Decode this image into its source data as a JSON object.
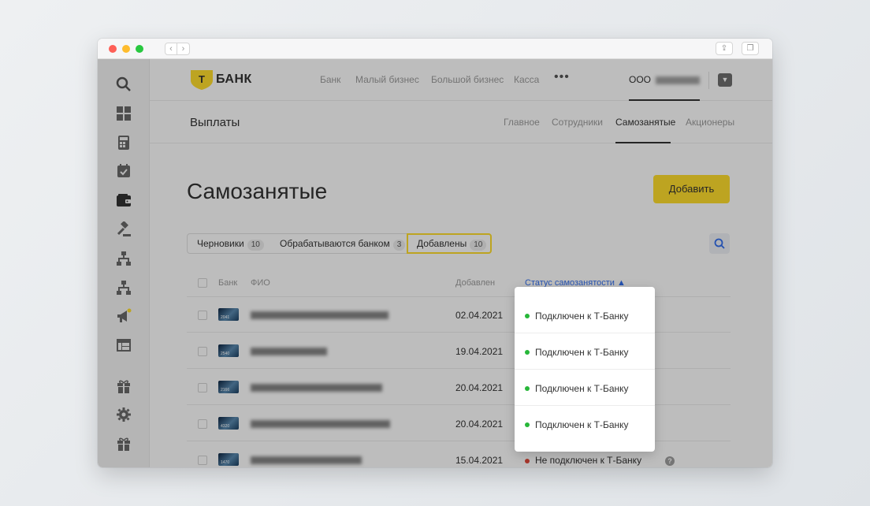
{
  "brand": {
    "name": "БАНК",
    "logo_letter": "Т",
    "logo_color": "#ffdd2d"
  },
  "topnav": {
    "items": [
      "Банк",
      "Малый бизнес",
      "Большой бизнес",
      "Касса"
    ],
    "more": "•••",
    "org_label": "ООО",
    "menu_icon": "chevron-down-icon"
  },
  "section": {
    "title": "Выплаты",
    "tabs": [
      "Главное",
      "Сотрудники",
      "Самозанятые",
      "Акционеры"
    ],
    "active_tab": "Самозанятые"
  },
  "page": {
    "title": "Самозанятые",
    "add_button": "Добавить"
  },
  "filters": [
    {
      "label": "Черновики",
      "count": "10"
    },
    {
      "label": "Обрабатываются банком",
      "count": "3"
    },
    {
      "label": "Добавлены",
      "count": "10",
      "active": true
    }
  ],
  "table": {
    "headers": {
      "bank": "Банк",
      "name": "ФИО",
      "added": "Добавлен",
      "status": "Статус самозанятости ▲"
    },
    "rows": [
      {
        "card": "2041",
        "date": "02.04.2021",
        "status": "Подключен к Т-Банку",
        "status_color": "#27b739"
      },
      {
        "card": "2540",
        "date": "19.04.2021",
        "status": "Подключен к Т-Банку",
        "status_color": "#27b739"
      },
      {
        "card": "2166",
        "date": "20.04.2021",
        "status": "Подключен к Т-Банку",
        "status_color": "#27b739"
      },
      {
        "card": "4320",
        "date": "20.04.2021",
        "status": "Подключен к Т-Банку",
        "status_color": "#27b739"
      },
      {
        "card": "1470",
        "date": "15.04.2021",
        "status": "Не подключен к Т-Банку",
        "status_color": "#e04a3b"
      }
    ]
  },
  "popover": {
    "items": [
      "Подключен к Т-Банку",
      "Подключен к Т-Банку",
      "Подключен к Т-Банку",
      "Подключен к Т-Банку"
    ]
  },
  "sidebar_icons": [
    "search-icon",
    "dashboard-icon",
    "calculator-icon",
    "calendar-icon",
    "wallet-icon",
    "gavel-icon",
    "org-chart-icon",
    "hierarchy-icon",
    "megaphone-icon",
    "table-icon",
    "gift-icon",
    "gear-icon",
    "gift-icon"
  ],
  "window": {
    "share_icon": "share-icon",
    "tabs_icon": "tabs-icon"
  }
}
